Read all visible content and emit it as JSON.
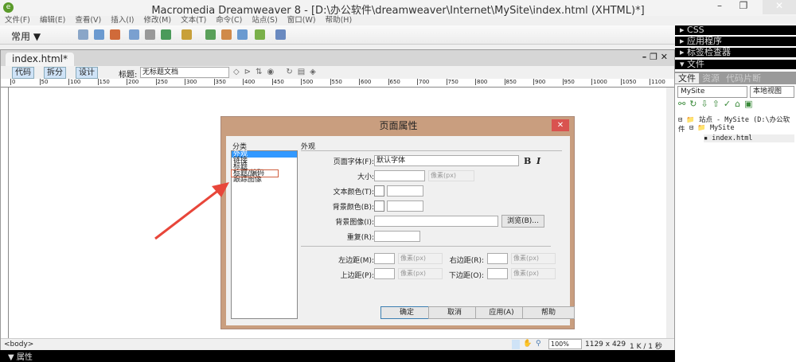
{
  "window": {
    "title": "Macromedia Dreamweaver 8 - [D:\\办公软件\\dreamweaver\\Internet\\MySite\\index.html (XHTML)*]",
    "minimize": "–",
    "restore": "❐",
    "close": "✕"
  },
  "menu": [
    "文件(F)",
    "编辑(E)",
    "查看(V)",
    "插入(I)",
    "修改(M)",
    "文本(T)",
    "命令(C)",
    "站点(S)",
    "窗口(W)",
    "帮助(H)"
  ],
  "insert_bar": {
    "category": "常用 ▼"
  },
  "document": {
    "tab": "index.html*",
    "controls": "– ❐ ✕",
    "views": [
      "代码",
      "拆分",
      "设计"
    ],
    "title_label": "标题:",
    "title_value": "无标题文档",
    "ruler_ticks": [
      "0",
      "50",
      "100",
      "150",
      "200",
      "250",
      "300",
      "350",
      "400",
      "450",
      "500",
      "550",
      "600",
      "650",
      "700",
      "750",
      "800",
      "850",
      "900",
      "950",
      "1000",
      "1050",
      "1100"
    ],
    "tag_selector": "<body>",
    "zoom": "100%",
    "dimensions": "1129 x 429",
    "size_time": "1 K / 1 秒"
  },
  "properties_panel": {
    "label": "▼ 属性"
  },
  "right_panels": {
    "groups": [
      "▸ CSS",
      "▸ 应用程序",
      "▸ 标签检查器",
      "▾ 文件"
    ],
    "tabs": [
      "文件",
      "资源",
      "代码片断"
    ],
    "site": "MySite",
    "view": "本地视图",
    "tree": [
      {
        "label": "站点 - MySite (D:\\办公软件"
      },
      {
        "label": "MySite"
      },
      {
        "label": "index.html"
      }
    ]
  },
  "dialog": {
    "title": "页面属性",
    "close": "✕",
    "category_header": "分类",
    "categories": [
      "外观",
      "链接",
      "标题",
      "标题/编码",
      "跟踪图像"
    ],
    "selected_category": "外观",
    "section": "外观",
    "fields": {
      "page_font_label": "页面字体(F):",
      "page_font": "默认字体",
      "bold": "B",
      "italic": "I",
      "size_label": "大小:",
      "size_unit": "像素(px)",
      "text_color_label": "文本颜色(T):",
      "bg_color_label": "背景颜色(B):",
      "bg_image_label": "背景图像(I):",
      "browse": "浏览(B)...",
      "repeat_label": "重复(R):",
      "left_margin_label": "左边距(M):",
      "right_margin_label": "右边距(R):",
      "top_margin_label": "上边距(P):",
      "bottom_margin_label": "下边距(O):",
      "margin_unit": "像素(px)"
    },
    "buttons": {
      "ok": "确定",
      "cancel": "取消",
      "apply": "应用(A)",
      "help": "帮助"
    }
  }
}
